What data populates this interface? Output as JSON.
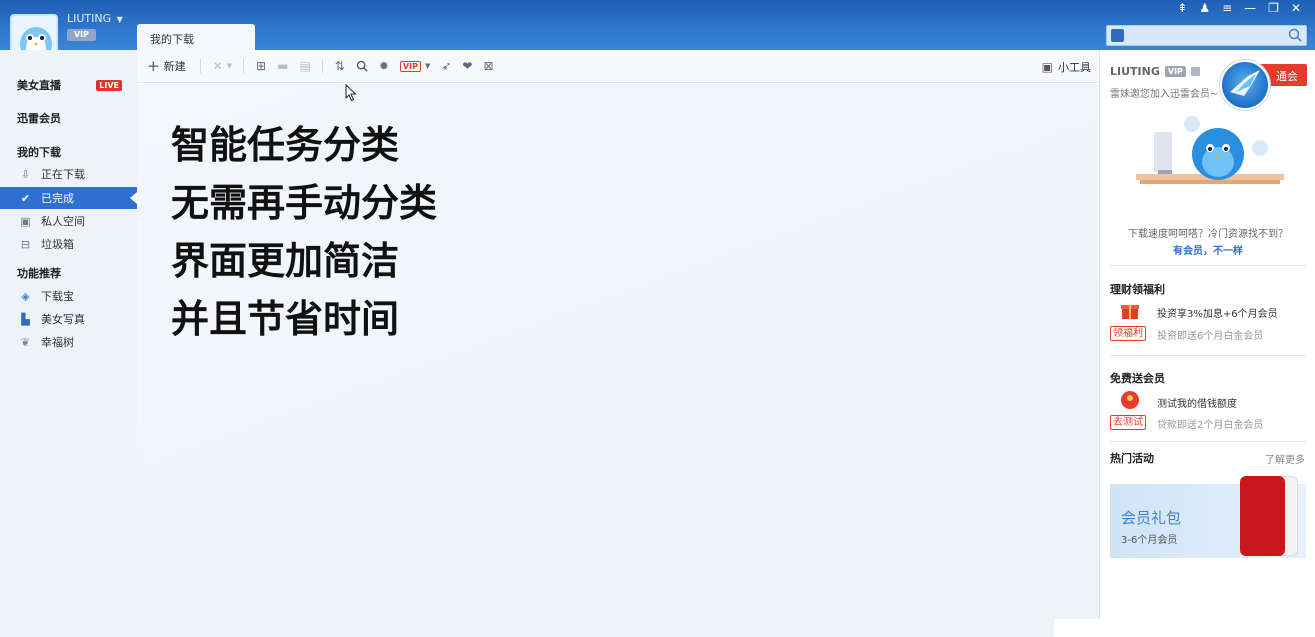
{
  "header": {
    "username": "LIUTING",
    "vip_label": "VIP",
    "active_tab": "我的下载",
    "window_controls": [
      "⇞",
      "♟",
      "≡",
      "—",
      "❐",
      "✕"
    ]
  },
  "sidebar": {
    "live": {
      "label": "美女直播",
      "badge": "LIVE"
    },
    "membership": "迅雷会员",
    "downloads_header": "我的下载",
    "items": [
      {
        "label": "正在下载",
        "icon": "download-icon"
      },
      {
        "label": "已完成",
        "icon": "check-icon",
        "active": true
      },
      {
        "label": "私人空间",
        "icon": "lock-icon"
      },
      {
        "label": "垃圾箱",
        "icon": "trash-icon"
      }
    ],
    "features_header": "功能推荐",
    "features": [
      {
        "label": "下载宝",
        "icon": "shield-icon"
      },
      {
        "label": "美女写真",
        "icon": "heel-icon"
      },
      {
        "label": "幸福树",
        "icon": "leaf-icon"
      }
    ]
  },
  "toolbar": {
    "new_label": "新建",
    "tools_label": "小工具"
  },
  "main": {
    "caption_lines": [
      "智能任务分类",
      "无需再手动分类",
      "界面更加简洁",
      "并且节省时间"
    ]
  },
  "right_panel": {
    "username": "LIUTING",
    "vip": "VIP",
    "open_button": "通会员",
    "invite": "雷妹邀您加入迅雷会员~",
    "question": "下载速度呵呵嗒？冷门资源找不到？",
    "cta": "有会员，不一样",
    "section1": {
      "title": "理财领福利",
      "line1": "投资享3%加息+6个月会员",
      "tag": "领福利",
      "line2": "投资即送6个月白金会员"
    },
    "section2": {
      "title": "免费送会员",
      "line1": "测试我的借钱额度",
      "tag": "去测试",
      "line2": "贷款即送2个月白金会员"
    },
    "hot": {
      "title": "热门活动",
      "more": "了解更多",
      "banner_title": "会员礼包",
      "banner_sub": "3-6个月会员"
    }
  },
  "colors": {
    "header_blue": "#2f78cf",
    "active_blue": "#2f6fd0",
    "accent_red": "#e53b2f"
  }
}
